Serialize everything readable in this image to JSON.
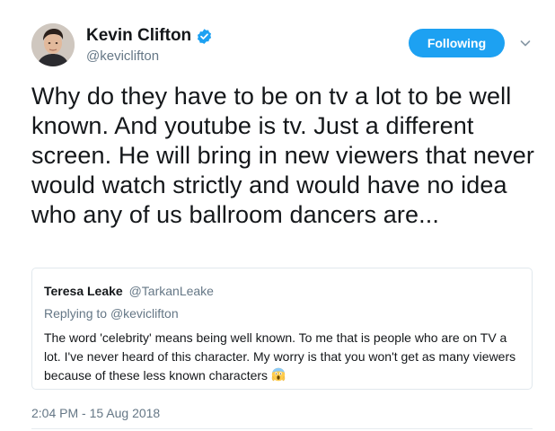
{
  "author": {
    "display_name": "Kevin Clifton",
    "handle": "@keviclifton",
    "verified": true,
    "avatar_icon": "profile-photo"
  },
  "follow_button": {
    "label": "Following",
    "color": "#1da1f2"
  },
  "menu_icon": "chevron-down-icon",
  "tweet": {
    "text": "Why do they have to be on tv a lot to be well known. And youtube is tv. Just a different screen. He will bring in new viewers that never would watch strictly and would have no idea who any of us ballroom dancers are..."
  },
  "quoted_tweet": {
    "display_name": "Teresa Leake",
    "handle": "@TarkanLeake",
    "replying_prefix": "Replying to",
    "replying_to": "@keviclifton",
    "text": "The word 'celebrity' means being well known. To me that is people who are on TV a lot.  I've never heard of this character.  My worry is that you won't get as many viewers because of these less known characters",
    "emoji_icon": "face-screaming-in-fear-icon"
  },
  "timestamp": "2:04 PM - 15 Aug 2018",
  "colors": {
    "accent": "#1da1f2",
    "text_primary": "#14171a",
    "text_secondary": "#657786",
    "border": "#e1e8ed"
  }
}
